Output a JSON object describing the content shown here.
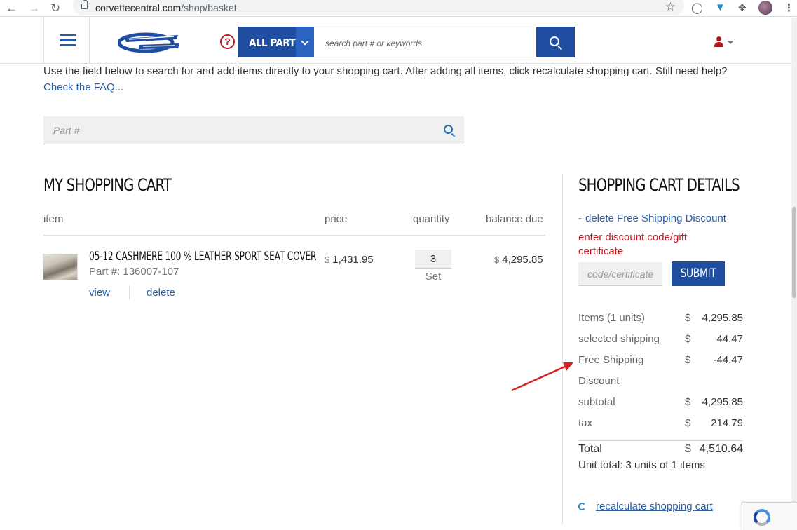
{
  "browser": {
    "url_domain": "corvettecentral.com",
    "url_path": "/shop/basket"
  },
  "header": {
    "all_parts_label": "ALL PARTS",
    "search_placeholder": "search part # or keywords",
    "help_icon_text": "?"
  },
  "intro": {
    "text": "Use the field below to search for and add items directly to your shopping cart. After adding all items, click recalculate shopping cart. Still need help?",
    "faq_link": "Check the FAQ",
    "faq_suffix": "..."
  },
  "part_search": {
    "placeholder": "Part #"
  },
  "cart": {
    "title": "MY SHOPPING CART",
    "columns": {
      "item": "item",
      "price": "price",
      "quantity": "quantity",
      "balance": "balance due"
    },
    "items": [
      {
        "name": "05-12 CASHMERE 100 % LEATHER SPORT SEAT COVER",
        "part_number": "Part #: 136007-107",
        "currency": "$",
        "price": "1,431.95",
        "quantity": "3",
        "unit": "Set",
        "balance": "4,295.85",
        "view_label": "view",
        "delete_label": "delete"
      }
    ]
  },
  "details": {
    "title": "SHOPPING CART DETAILS",
    "delete_discount_dash": "-",
    "delete_discount": "delete Free Shipping Discount",
    "enter_code": "enter discount code/gift certificate",
    "code_placeholder": "code/certificate",
    "submit_label": "SUBMIT",
    "rows": [
      {
        "label": "Items (1 units)",
        "currency": "$",
        "value": "4,295.85"
      },
      {
        "label": "selected shipping",
        "currency": "$",
        "value": "44.47"
      },
      {
        "label": "Free Shipping",
        "currency": "$",
        "value": "-44.47"
      },
      {
        "label": "Discount",
        "currency": "",
        "value": ""
      },
      {
        "label": "subtotal",
        "currency": "$",
        "value": "4,295.85"
      },
      {
        "label": "tax",
        "currency": "$",
        "value": "214.79"
      }
    ],
    "total": {
      "label": "Total",
      "currency": "$",
      "value": "4,510.64"
    },
    "unit_total": "Unit total: 3 units of 1 items",
    "recalculate": "recalculate shopping cart"
  },
  "colors": {
    "brand_blue": "#1f4ea1",
    "link_blue": "#2a5ea8",
    "alert_red": "#c4161c",
    "annotation_arrow": "#d61f1f"
  },
  "icons": [
    "back-icon",
    "forward-icon",
    "reload-icon",
    "lock-icon",
    "star-icon",
    "hamburger-icon",
    "help-icon",
    "search-icon",
    "user-icon",
    "refresh-icon",
    "recaptcha-icon"
  ]
}
